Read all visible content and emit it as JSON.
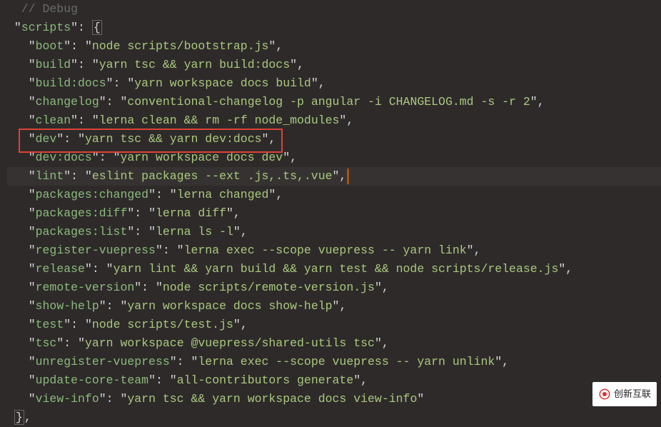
{
  "comment_line": "  // Debug",
  "root_key": "scripts",
  "entries": [
    {
      "key": "boot",
      "value": "node scripts/bootstrap.js",
      "trail": ","
    },
    {
      "key": "build",
      "value": "yarn tsc && yarn build:docs",
      "trail": ","
    },
    {
      "key": "build:docs",
      "value": "yarn workspace docs build",
      "trail": ","
    },
    {
      "key": "changelog",
      "value": "conventional-changelog -p angular -i CHANGELOG.md -s -r 2",
      "trail": ","
    },
    {
      "key": "clean",
      "value": "lerna clean && rm -rf node_modules",
      "trail": ","
    },
    {
      "key": "dev",
      "value": "yarn tsc && yarn dev:docs",
      "trail": ",",
      "boxed": true
    },
    {
      "key": "dev:docs",
      "value": "yarn workspace docs dev",
      "trail": ","
    },
    {
      "key": "lint",
      "value": "eslint packages --ext .js,.ts,.vue",
      "trail": ",",
      "highlight": true,
      "cursor_after": true
    },
    {
      "key": "packages:changed",
      "value": "lerna changed",
      "trail": ","
    },
    {
      "key": "packages:diff",
      "value": "lerna diff",
      "trail": ","
    },
    {
      "key": "packages:list",
      "value": "lerna ls -l",
      "trail": ","
    },
    {
      "key": "register-vuepress",
      "value": "lerna exec --scope vuepress -- yarn link",
      "trail": ","
    },
    {
      "key": "release",
      "value": "yarn lint && yarn build && yarn test && node scripts/release.js",
      "trail": ","
    },
    {
      "key": "remote-version",
      "value": "node scripts/remote-version.js",
      "trail": ","
    },
    {
      "key": "show-help",
      "value": "yarn workspace docs show-help",
      "trail": ","
    },
    {
      "key": "test",
      "value": "node scripts/test.js",
      "trail": ","
    },
    {
      "key": "tsc",
      "value": "yarn workspace @vuepress/shared-utils tsc",
      "trail": ","
    },
    {
      "key": "unregister-vuepress",
      "value": "lerna exec --scope vuepress -- yarn unlink",
      "trail": ","
    },
    {
      "key": "update-core-team",
      "value": "all-contributors generate",
      "trail": ","
    },
    {
      "key": "view-info",
      "value": "yarn tsc && yarn workspace docs view-info",
      "trail": ""
    }
  ],
  "close_brace_trail": ",",
  "watermark": "创新互联"
}
